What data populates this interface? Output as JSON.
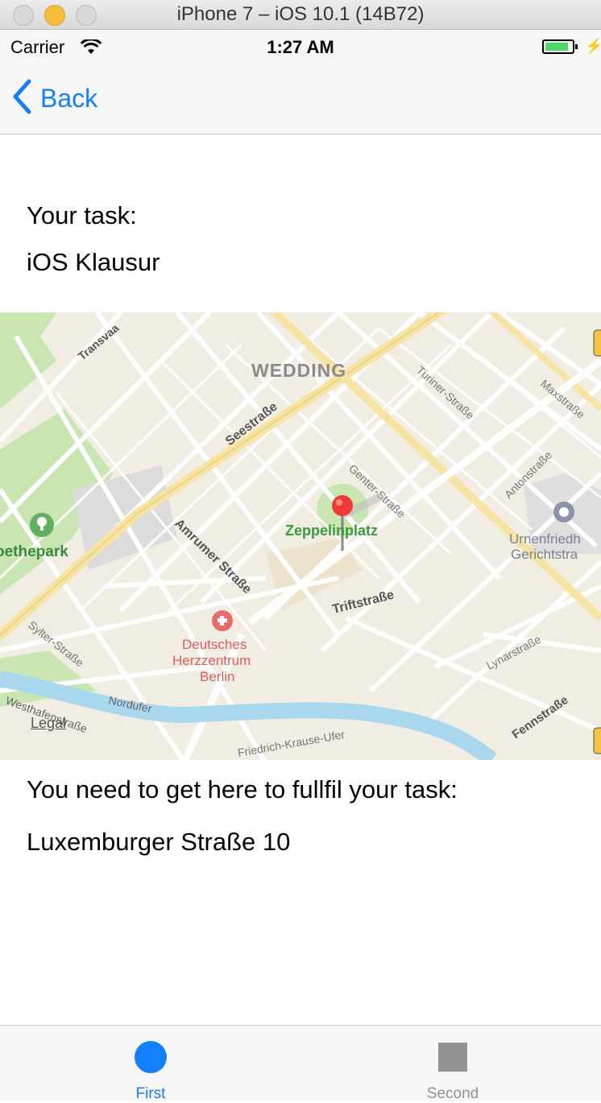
{
  "simulator": {
    "title": "iPhone 7 – iOS 10.1 (14B72)"
  },
  "status_bar": {
    "carrier": "Carrier",
    "time": "1:27 AM",
    "battery_color": "#4cd964"
  },
  "nav": {
    "back_label": "Back",
    "accent": "#157efb"
  },
  "task": {
    "header": "Your task:",
    "name": "iOS Klausur"
  },
  "map": {
    "district": "WEDDING",
    "pin_label": "Zeppelinplatz",
    "poi_park": "oethepark",
    "hospital": [
      "Deutsches",
      "Herzzentrum",
      "Berlin"
    ],
    "landmark": [
      "Urnenfriedh",
      "Gerichtstra"
    ],
    "streets": {
      "transvaal": "Transvaa",
      "seestrasse": "Seestraße",
      "turiner": "Turiner-Straße",
      "maxstrasse": "Maxstraße",
      "genter": "Genter-Straße",
      "antonstrasse": "Antonstraße",
      "amrumer": "Amrumer Straße",
      "triftstrasse": "Triftstraße",
      "lynarstrasse": "Lynarstraße",
      "sylter": "Sylter-Straße",
      "nordufer": "Nordufer",
      "westhafen": "Westhafenstraße",
      "friedrich_krause": "Friedrich-Krause-Ufer",
      "fennstrasse": "Fennstraße"
    },
    "legal": "Legal"
  },
  "destination": {
    "header": "You need to get here to fullfil your task:",
    "address": "Luxemburger Straße 10"
  },
  "tabs": [
    {
      "label": "First"
    },
    {
      "label": "Second"
    }
  ]
}
